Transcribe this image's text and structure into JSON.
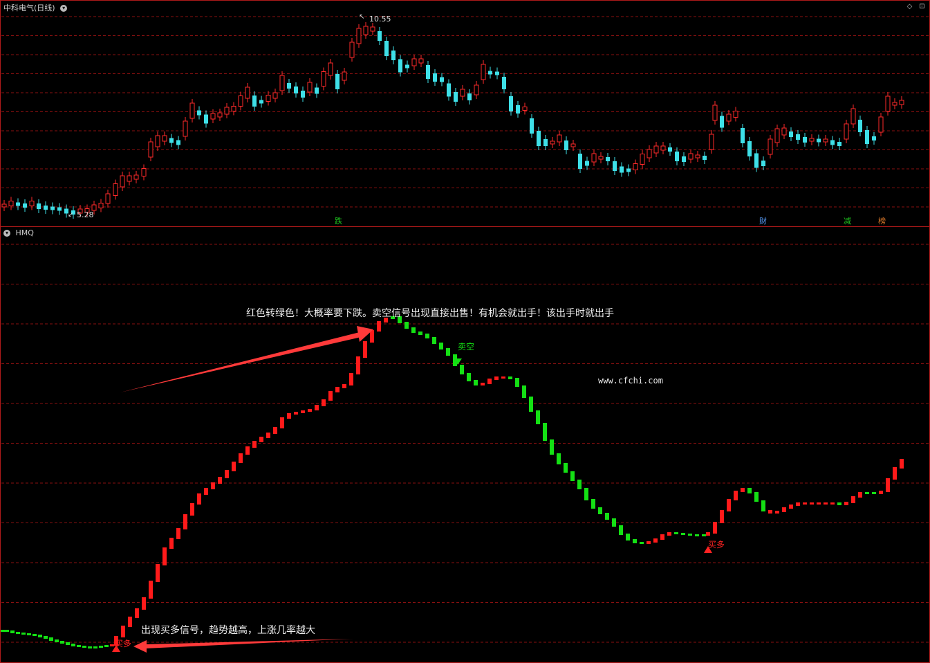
{
  "header": {
    "title": "中科电气(日线)",
    "indicator": "HMQ"
  },
  "price_chart": {
    "high_label": "10.55",
    "low_label": "5.28",
    "event_markers": [
      {
        "text": "跌",
        "color": "#1ec81e"
      },
      {
        "text": "财",
        "color": "#5aa0ff"
      },
      {
        "text": "减",
        "color": "#1ec81e"
      },
      {
        "text": "榜",
        "color": "#e07a2a"
      }
    ]
  },
  "indicator_chart": {
    "annotation_top": "红色转绿色！大概率要下跌。卖空信号出现直接出售！有机会就出手！该出手时就出手",
    "annotation_bottom": "出现买多信号，趋势越高，上涨几率越大",
    "watermark": "www.cfchi.com",
    "signals": [
      {
        "label": "卖空",
        "type": "sell"
      },
      {
        "label": "买多",
        "type": "buy"
      },
      {
        "label": "买多",
        "type": "buy"
      }
    ]
  },
  "colors": {
    "up": "#ff2a2a",
    "down": "#3ee0e8",
    "ind_up": "#ff1a1a",
    "ind_down": "#14e014",
    "grid": "#8a1010",
    "arrow": "#ff3a3a"
  }
}
